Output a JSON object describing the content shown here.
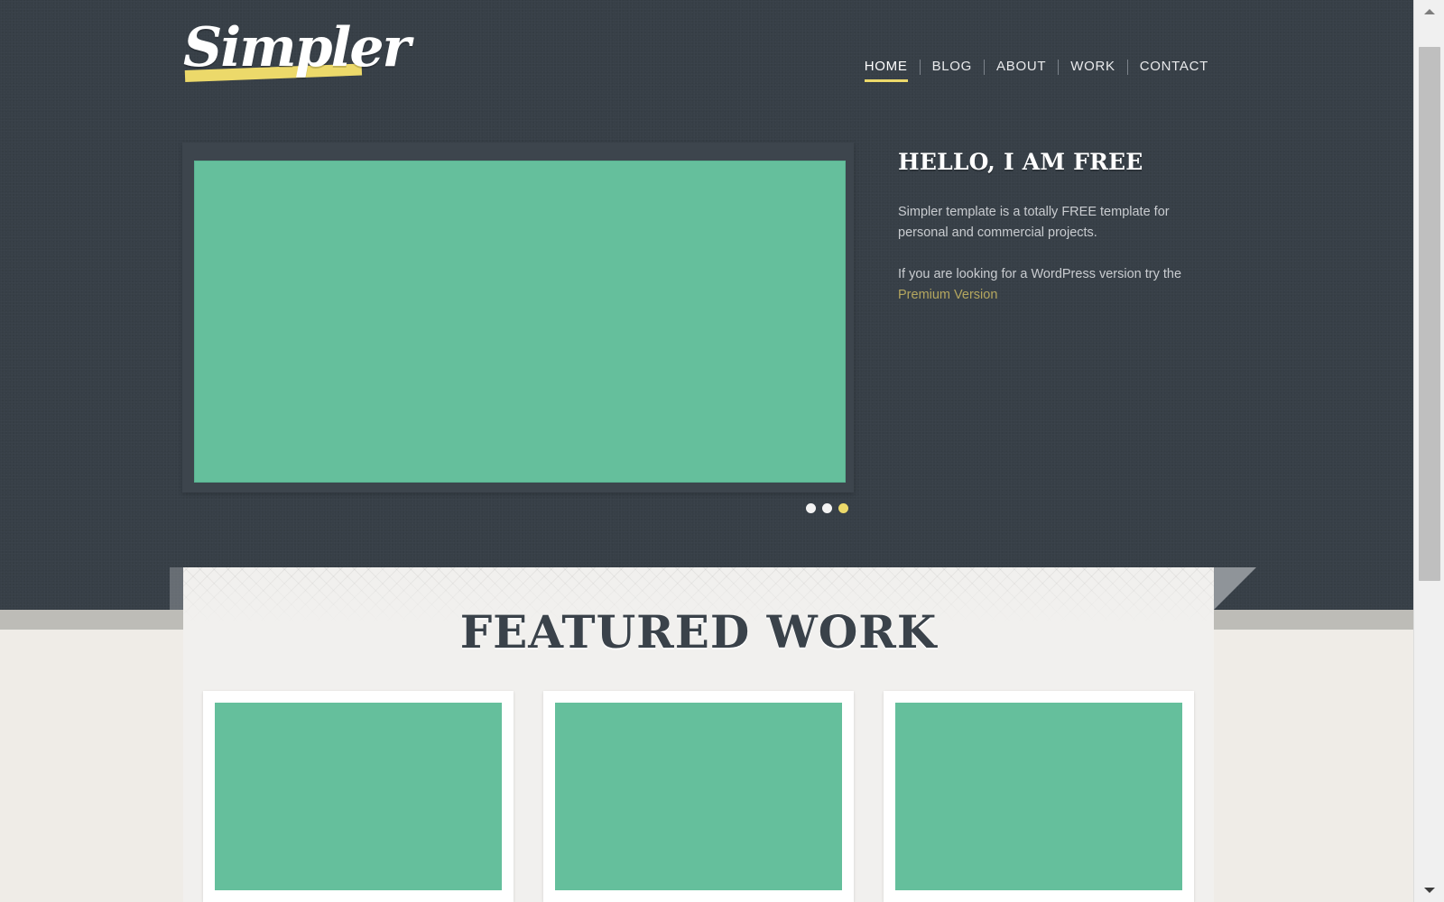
{
  "site": {
    "logo_text": "Simpler",
    "nav": [
      {
        "label": "HOME",
        "active": true
      },
      {
        "label": "BLOG",
        "active": false
      },
      {
        "label": "ABOUT",
        "active": false
      },
      {
        "label": "WORK",
        "active": false
      },
      {
        "label": "CONTACT",
        "active": false
      }
    ]
  },
  "hero": {
    "title": "HELLO, I AM FREE",
    "paragraph_1": "Simpler template is a totally FREE template for personal and commercial projects.",
    "paragraph_2": "If you are looking for a WordPress version try the",
    "link_label": "Premium Version",
    "slider": {
      "dots": [
        {
          "active": false
        },
        {
          "active": false
        },
        {
          "active": true
        }
      ]
    }
  },
  "featured": {
    "title": "FEATURED WORK",
    "cards": [
      {
        "name": "work-card-1"
      },
      {
        "name": "work-card-2"
      },
      {
        "name": "work-card-3"
      }
    ]
  },
  "colors": {
    "dark_band": "#373f47",
    "accent_yellow": "#ecd96a",
    "accent_green": "#65bf9c",
    "link_gold": "#b5a75f",
    "panel_gray": "#f1f0ee",
    "page_cream": "#efece7",
    "strip_gray": "#bdbcb7"
  },
  "browser": {
    "scroll_up_icon": "triangle-up-icon",
    "scroll_down_icon": "triangle-down-icon"
  }
}
